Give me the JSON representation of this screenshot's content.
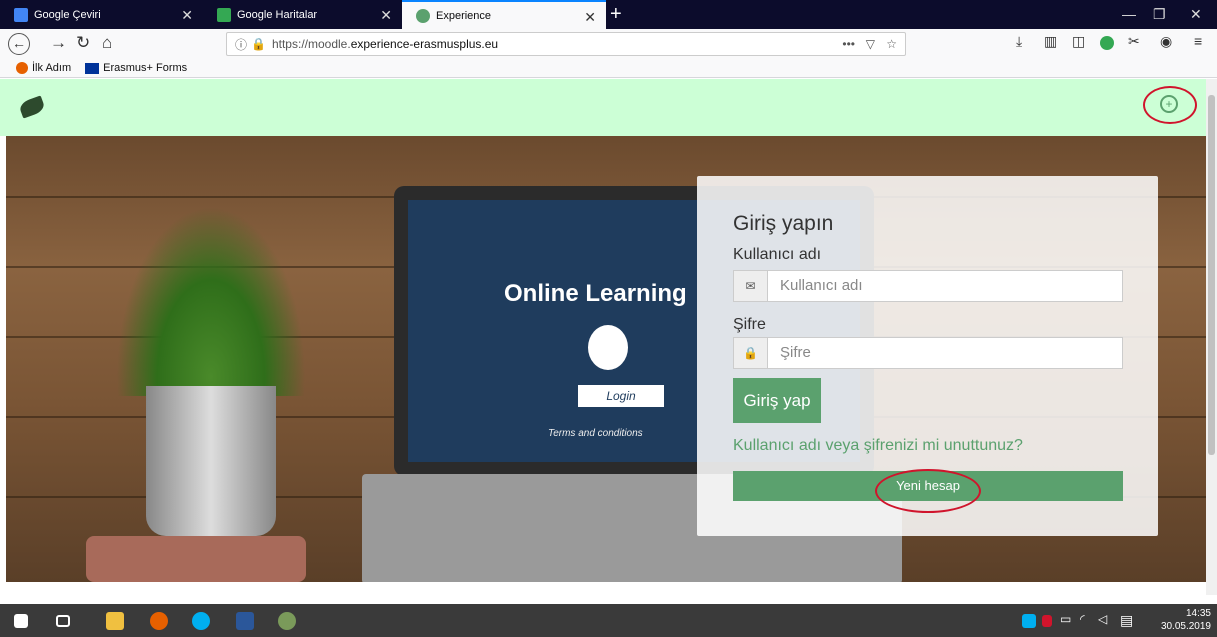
{
  "tabs": [
    {
      "label": "Google Çeviri",
      "icon": "google-translate-icon",
      "color": "#4285f4"
    },
    {
      "label": "Google Haritalar",
      "icon": "google-maps-icon",
      "color": "#34a853"
    },
    {
      "label": "Experience",
      "icon": "experience-leaf-icon",
      "color": "#5ba16e"
    }
  ],
  "url": {
    "prefix": "https://moodle.",
    "host": "experience-erasmusplus.eu"
  },
  "bookmarks": [
    {
      "label": "İlk Adım",
      "icon": "firefox-icon"
    },
    {
      "label": "Erasmus+ Forms",
      "icon": "eu-flag-icon"
    }
  ],
  "hero": {
    "screen_title": "Online Learning",
    "screen_login": "Login",
    "screen_terms": "Terms and conditions"
  },
  "login": {
    "title": "Giriş yapın",
    "username_label": "Kullanıcı adı",
    "username_placeholder": "Kullanıcı adı",
    "password_label": "Şifre",
    "password_placeholder": "Şifre",
    "submit_label": "Giriş yap",
    "forgot_label": "Kullanıcı adı veya şifrenizi mi unuttunuz?",
    "new_account_label": "Yeni hesap"
  },
  "clock": {
    "time": "14:35",
    "date": "30.05.2019"
  },
  "colors": {
    "accent": "#5ba16e",
    "topstrip": "#ccffd6",
    "annotation": "#d0142c"
  }
}
